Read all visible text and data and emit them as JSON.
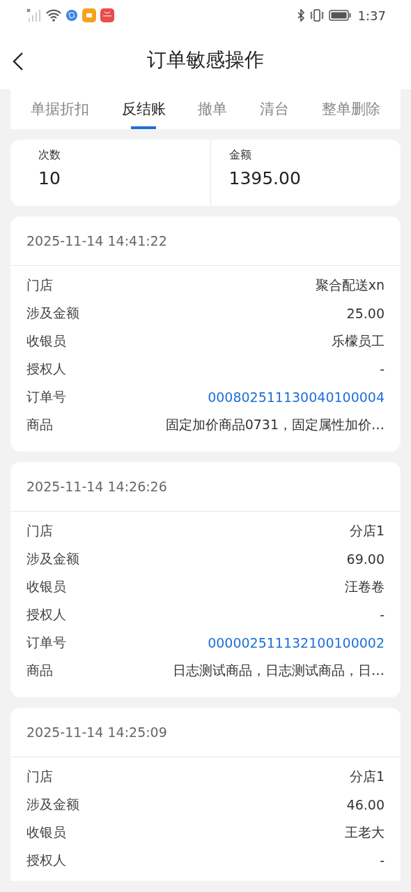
{
  "status_bar": {
    "time": "1:37"
  },
  "header": {
    "title": "订单敏感操作"
  },
  "tabs": [
    {
      "label": "单据折扣",
      "selected": false
    },
    {
      "label": "反结账",
      "selected": true
    },
    {
      "label": "撤单",
      "selected": false
    },
    {
      "label": "清台",
      "selected": false
    },
    {
      "label": "整单删除",
      "selected": false
    }
  ],
  "summary": [
    {
      "label": "次数",
      "value": "10"
    },
    {
      "label": "金额",
      "value": "1395.00"
    }
  ],
  "records": [
    {
      "time": "2025-11-14 14:41:22",
      "fields": [
        {
          "label": "门店",
          "value": "聚合配送xn",
          "kind": "text"
        },
        {
          "label": "涉及金额",
          "value": "25.00",
          "kind": "text"
        },
        {
          "label": "收银员",
          "value": "乐檬员工",
          "kind": "text"
        },
        {
          "label": "授权人",
          "value": "-",
          "kind": "text"
        },
        {
          "label": "订单号",
          "value": "000802511130040100004",
          "kind": "link"
        },
        {
          "label": "商品",
          "value": "固定加价商品0731，固定属性加价…",
          "kind": "text"
        }
      ]
    },
    {
      "time": "2025-11-14 14:26:26",
      "fields": [
        {
          "label": "门店",
          "value": "分店1",
          "kind": "text"
        },
        {
          "label": "涉及金额",
          "value": "69.00",
          "kind": "text"
        },
        {
          "label": "收银员",
          "value": "汪卷卷",
          "kind": "text"
        },
        {
          "label": "授权人",
          "value": "-",
          "kind": "text"
        },
        {
          "label": "订单号",
          "value": "000002511132100100002",
          "kind": "link"
        },
        {
          "label": "商品",
          "value": "日志测试商品，日志测试商品，日…",
          "kind": "text"
        }
      ]
    },
    {
      "time": "2025-11-14 14:25:09",
      "fields": [
        {
          "label": "门店",
          "value": "分店1",
          "kind": "text"
        },
        {
          "label": "涉及金额",
          "value": "46.00",
          "kind": "text"
        },
        {
          "label": "收银员",
          "value": "王老大",
          "kind": "text"
        },
        {
          "label": "授权人",
          "value": "-",
          "kind": "text"
        }
      ]
    }
  ]
}
